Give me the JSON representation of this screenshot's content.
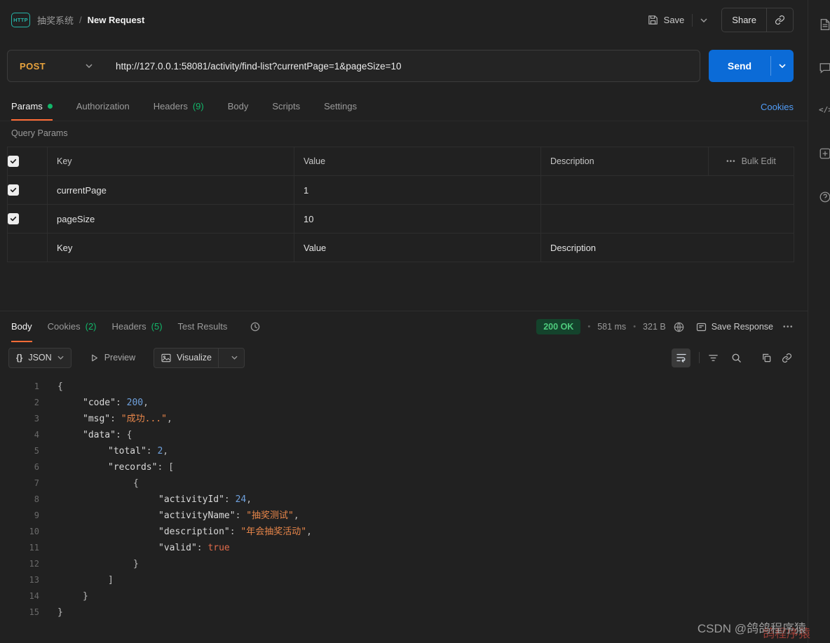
{
  "header": {
    "app_icon": "HTTP",
    "workspace": "抽奖系统",
    "separator": "/",
    "request_title": "New Request",
    "save_label": "Save",
    "share_label": "Share"
  },
  "request": {
    "method": "POST",
    "url": "http://127.0.0.1:58081/activity/find-list?currentPage=1&pageSize=10",
    "send_label": "Send"
  },
  "request_tabs": {
    "params": "Params",
    "authorization": "Authorization",
    "headers": "Headers",
    "headers_count": "(9)",
    "body": "Body",
    "scripts": "Scripts",
    "settings": "Settings",
    "cookies_link": "Cookies"
  },
  "query_params": {
    "title": "Query Params",
    "col_key": "Key",
    "col_value": "Value",
    "col_description": "Description",
    "bulk_edit": "Bulk Edit",
    "bulk_edit_icon": "•••",
    "rows": [
      {
        "key": "currentPage",
        "value": "1"
      },
      {
        "key": "pageSize",
        "value": "10"
      }
    ],
    "placeholder": {
      "key": "Key",
      "value": "Value",
      "description": "Description"
    }
  },
  "response": {
    "tab_body": "Body",
    "tab_cookies": "Cookies",
    "cookies_count": "(2)",
    "tab_headers": "Headers",
    "headers_count": "(5)",
    "tab_tests": "Test Results",
    "status": "200 OK",
    "dot": "•",
    "time": "581 ms",
    "size": "321 B",
    "save_response": "Save Response",
    "more": "•••",
    "format_icon": "{}",
    "format": "JSON",
    "preview": "Preview",
    "visualize": "Visualize"
  },
  "code": {
    "line_numbers": [
      "1",
      "2",
      "3",
      "4",
      "5",
      "6",
      "7",
      "8",
      "9",
      "10",
      "11",
      "12",
      "13",
      "14",
      "15"
    ],
    "l1": {
      "p": "{"
    },
    "l2": {
      "k": "\"code\"",
      "c": ": ",
      "n": "200",
      "p": ","
    },
    "l3": {
      "k": "\"msg\"",
      "c": ": ",
      "s": "\"成功...\"",
      "p": ","
    },
    "l4": {
      "k": "\"data\"",
      "c": ": ",
      "p": "{"
    },
    "l5": {
      "k": "\"total\"",
      "c": ": ",
      "n": "2",
      "p": ","
    },
    "l6": {
      "k": "\"records\"",
      "c": ": ",
      "p": "["
    },
    "l7": {
      "p": "{"
    },
    "l8": {
      "k": "\"activityId\"",
      "c": ": ",
      "n": "24",
      "p": ","
    },
    "l9": {
      "k": "\"activityName\"",
      "c": ": ",
      "s": "\"抽奖测试\"",
      "p": ","
    },
    "l10": {
      "k": "\"description\"",
      "c": ": ",
      "s": "\"年会抽奖活动\"",
      "p": ","
    },
    "l11": {
      "k": "\"valid\"",
      "c": ": ",
      "b": "true"
    },
    "l12": {
      "p": "}"
    },
    "l13": {
      "p": "]"
    },
    "l14": {
      "p": "}"
    },
    "l15": {
      "p": "}"
    }
  },
  "watermark": {
    "text": "CSDN @鸽鸽程序猿",
    "shadow": "鸽程序猿"
  },
  "code_rail_icon": "</>"
}
